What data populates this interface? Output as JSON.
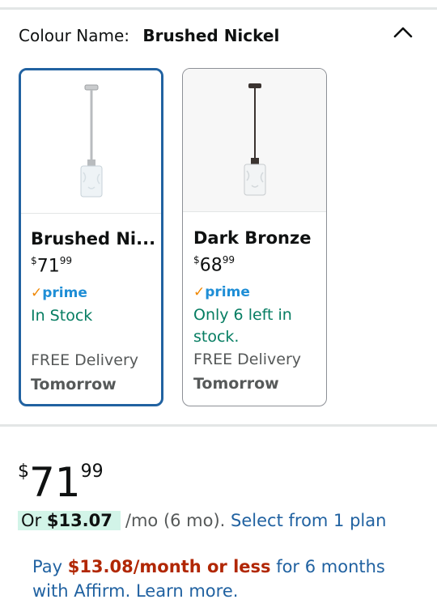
{
  "variation": {
    "label": "Colour Name:",
    "selected_value": "Brushed Nickel"
  },
  "options": [
    {
      "name": "Brushed Ni...",
      "price_symbol": "$",
      "price_whole": "71",
      "price_fraction": "99",
      "prime_check": "✓",
      "prime_text": "prime",
      "stock": "In Stock",
      "delivery": "FREE Delivery",
      "delivery_when": "Tomorrow",
      "finish_color": "#b9bcbf"
    },
    {
      "name": "Dark Bronze",
      "price_symbol": "$",
      "price_whole": "68",
      "price_fraction": "99",
      "prime_check": "✓",
      "prime_text": "prime",
      "stock": "Only 6 left in stock.",
      "delivery": "FREE Delivery",
      "delivery_when": "Tomorrow",
      "finish_color": "#3a3330"
    }
  ],
  "price": {
    "symbol": "$",
    "whole": "71",
    "fraction": "99"
  },
  "installment": {
    "prefix": "Or ",
    "amount": "$13.07",
    "term": "/mo (6 mo).",
    "link": "Select from 1 plan"
  },
  "affirm": {
    "pre": "Pay ",
    "amount": "$13.08/month or less",
    "post": " for 6 months with Affirm. Learn more."
  },
  "colors": {
    "link": "#2162a1",
    "selected_border": "#2162a1",
    "in_stock": "#067d62",
    "deal_red": "#b12704",
    "prime_blue": "#1f8ed6",
    "prime_check": "#f08804"
  }
}
